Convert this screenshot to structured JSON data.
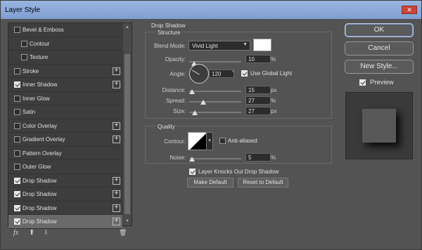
{
  "window": {
    "title": "Layer Style",
    "close_glyph": "✕"
  },
  "styles_list": [
    {
      "label": "Bevel & Emboss",
      "checked": false,
      "indent": 0,
      "plus": false
    },
    {
      "label": "Contour",
      "checked": false,
      "indent": 1,
      "plus": false
    },
    {
      "label": "Texture",
      "checked": false,
      "indent": 1,
      "plus": false
    },
    {
      "label": "Stroke",
      "checked": false,
      "indent": 0,
      "plus": true
    },
    {
      "label": "Inner Shadow",
      "checked": true,
      "indent": 0,
      "plus": true
    },
    {
      "label": "Inner Glow",
      "checked": false,
      "indent": 0,
      "plus": false
    },
    {
      "label": "Satin",
      "checked": false,
      "indent": 0,
      "plus": false
    },
    {
      "label": "Color Overlay",
      "checked": false,
      "indent": 0,
      "plus": true
    },
    {
      "label": "Gradient Overlay",
      "checked": false,
      "indent": 0,
      "plus": true
    },
    {
      "label": "Pattern Overlay",
      "checked": false,
      "indent": 0,
      "plus": false
    },
    {
      "label": "Outer Glow",
      "checked": false,
      "indent": 0,
      "plus": false
    },
    {
      "label": "Drop Shadow",
      "checked": true,
      "indent": 0,
      "plus": true
    },
    {
      "label": "Drop Shadow",
      "checked": true,
      "indent": 0,
      "plus": true
    },
    {
      "label": "Drop Shadow",
      "checked": true,
      "indent": 0,
      "plus": true
    },
    {
      "label": "Drop Shadow",
      "checked": true,
      "indent": 0,
      "plus": true,
      "selected": true
    }
  ],
  "plus_glyph": "+",
  "scroll": {
    "up": "▲",
    "down": "▼"
  },
  "toolbar": {
    "fx": "fx",
    "up": "⬆",
    "down": "⬇",
    "trash": "🗑"
  },
  "drop_shadow": {
    "heading": "Drop Shadow",
    "structure_label": "Structure",
    "blend_mode_label": "Blend Mode:",
    "blend_mode_value": "Vivid Light",
    "opacity_label": "Opacity:",
    "opacity_value": "10",
    "opacity_unit": "%",
    "opacity_fraction": 0.1,
    "angle_label": "Angle:",
    "angle_value": "120",
    "angle_unit": "°",
    "use_global_light_label": "Use Global Light",
    "use_global_light": true,
    "distance_label": "Distance:",
    "distance_value": "15",
    "distance_unit": "px",
    "distance_fraction": 0.05,
    "spread_label": "Spread:",
    "spread_value": "27",
    "spread_unit": "%",
    "spread_fraction": 0.27,
    "size_label": "Size:",
    "size_value": "27",
    "size_unit": "px",
    "size_fraction": 0.11,
    "quality_label": "Quality",
    "contour_label": "Contour:",
    "anti_aliased_label": "Anti-aliased",
    "anti_aliased": false,
    "noise_label": "Noise:",
    "noise_value": "5",
    "noise_unit": "%",
    "noise_fraction": 0.05,
    "knocks_out_label": "Layer Knocks Out Drop Shadow",
    "knocks_out": true,
    "make_default_label": "Make Default",
    "reset_default_label": "Reset to Default"
  },
  "right": {
    "ok_label": "OK",
    "cancel_label": "Cancel",
    "new_style_label": "New Style...",
    "preview_label": "Preview",
    "preview_checked": true
  },
  "colors": {
    "accent": "#7c9bd1",
    "dialog_bg": "#535353",
    "panel_bg": "#3d3d3d",
    "selected_row": "#6a6a6a"
  }
}
